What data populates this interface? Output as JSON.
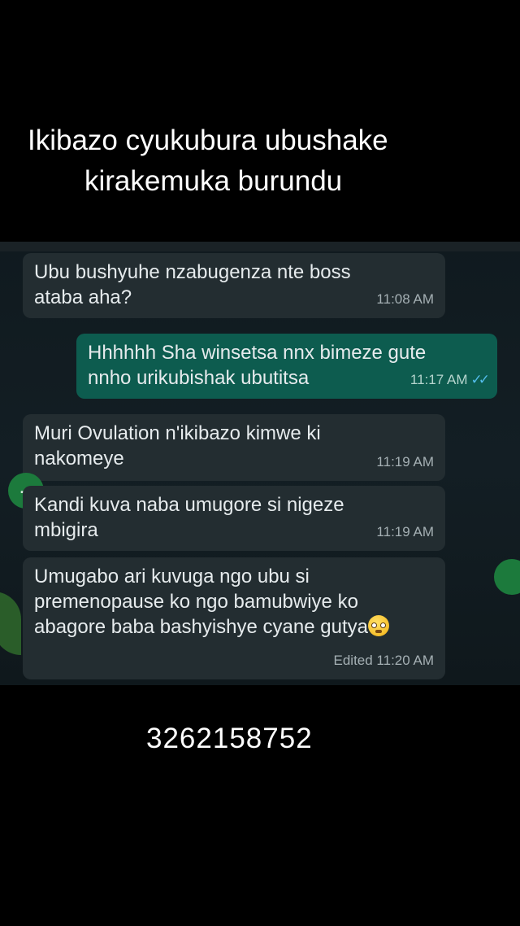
{
  "caption": {
    "line1": "Ikibazo cyukubura ubushake",
    "line2": "kirakemuka burundu"
  },
  "chat": {
    "messages": [
      {
        "direction": "incoming",
        "text": "Ubu bushyuhe nzabugenza nte boss\nataba aha?",
        "time": "11:08 AM"
      },
      {
        "direction": "outgoing",
        "text": "Hhhhhh Sha winsetsa nnx bimeze gute\nnnho urikubishak ubutitsa",
        "time": "11:17 AM",
        "status_icon": "double-check-read-icon",
        "status_color": "#53bdeb"
      },
      {
        "direction": "incoming",
        "text": "Muri Ovulation n'ikibazo kimwe ki\nnakomeye",
        "time": "11:19 AM"
      },
      {
        "direction": "incoming",
        "text": "Kandi kuva naba umugore si nigeze\nmbigira",
        "time": "11:19 AM"
      },
      {
        "direction": "incoming",
        "text": "Umugabo ari kuvuga ngo ubu si\npremenopause ko ngo bamubwiye ko\nabagore baba bashyishye cyane gutya",
        "emoji": "woozy-face-emoji",
        "time": "Edited 11:20 AM"
      }
    ],
    "side_button": {
      "label": "...",
      "icon": "more-dots-icon",
      "color": "#1c7a3c"
    }
  },
  "footer": {
    "number": "3262158752"
  },
  "colors": {
    "background": "#000000",
    "incoming_bubble": "#232d31",
    "outgoing_bubble": "#0d5c4f"
  }
}
